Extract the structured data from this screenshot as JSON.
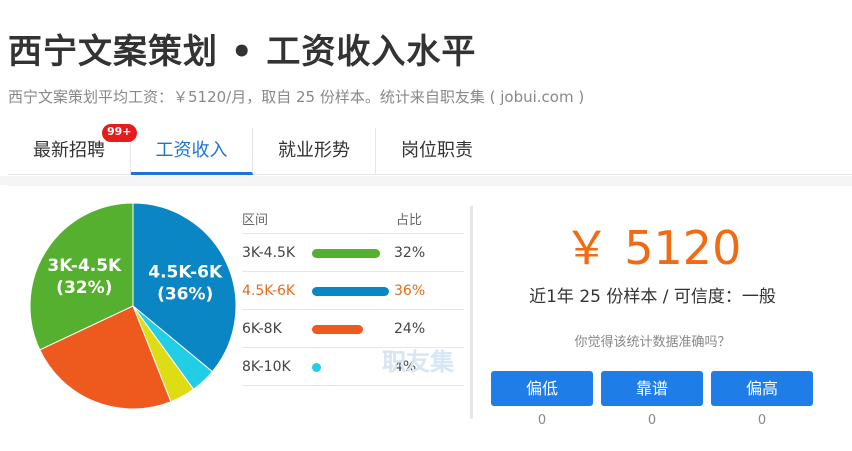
{
  "header": {
    "title": "西宁文案策划 • 工资收入水平",
    "subtitle": "西宁文案策划平均工资：￥5120/月，取自 25 份样本。统计来自职友集 ( jobui.com )"
  },
  "tabs": [
    {
      "label": "最新招聘",
      "badge": "99+"
    },
    {
      "label": "工资收入"
    },
    {
      "label": "就业形势"
    },
    {
      "label": "岗位职责"
    }
  ],
  "pie": {
    "slices": [
      {
        "label": "4.5K-6K",
        "pct_text": "(36%)",
        "value": 36,
        "color": "#0b86c5"
      },
      {
        "label": "",
        "pct_text": "",
        "value": 4,
        "color": "#22cde5"
      },
      {
        "label": "",
        "pct_text": "",
        "value": 4,
        "color": "#dedc15"
      },
      {
        "label": "",
        "pct_text": "",
        "value": 24,
        "color": "#ee5a1e"
      },
      {
        "label": "3K-4.5K",
        "pct_text": "(32%)",
        "value": 32,
        "color": "#56b02f"
      }
    ]
  },
  "legend": {
    "head_range": "区间",
    "head_pct": "占比",
    "rows": [
      {
        "range": "3K-4.5K",
        "pct": "32%",
        "value": 32,
        "color": "#56b02f"
      },
      {
        "range": "4.5K-6K",
        "pct": "36%",
        "value": 36,
        "color": "#0b86c5"
      },
      {
        "range": "6K-8K",
        "pct": "24%",
        "value": 24,
        "color": "#ee5a1e"
      },
      {
        "range": "8K-10K",
        "pct": "4%",
        "value": 4,
        "color": "#22cde5"
      }
    ]
  },
  "watermark": "职友集",
  "summary": {
    "salary": "￥ 5120",
    "samples": "近1年 25 份样本 / 可信度：一般",
    "question": "你觉得该统计数据准确吗？"
  },
  "votes": [
    {
      "label": "偏低",
      "count": "0"
    },
    {
      "label": "靠谱",
      "count": "0"
    },
    {
      "label": "偏高",
      "count": "0"
    }
  ],
  "colors": {
    "accent": "#1a76d2",
    "button": "#1e7de6",
    "salary": "#ef6c12",
    "badge": "#e31c1c"
  }
}
